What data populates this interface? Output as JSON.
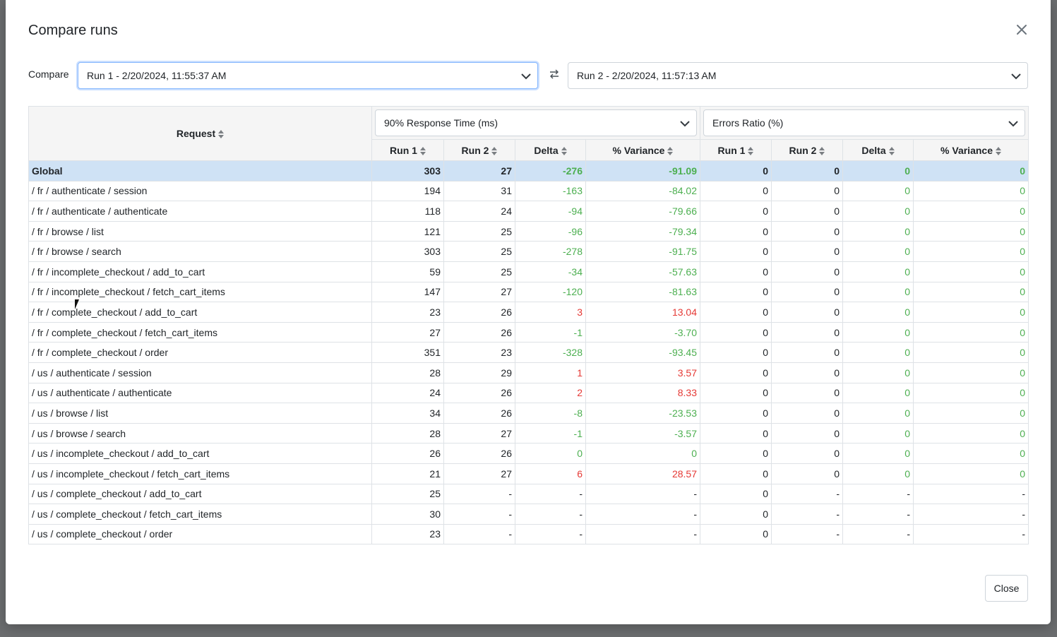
{
  "modal": {
    "title": "Compare runs",
    "close_icon": "close-icon",
    "compare_label": "Compare",
    "run_a": "Run 1 - 2/20/2024, 11:55:37 AM",
    "run_b": "Run 2 - 2/20/2024, 11:57:13 AM",
    "swap_icon": "swap-icon",
    "close_button": "Close"
  },
  "table": {
    "request_header": "Request",
    "metric_a": "90% Response Time (ms)",
    "metric_b": "Errors Ratio (%)",
    "sub_headers": [
      "Run 1",
      "Run 2",
      "Delta",
      "% Variance",
      "Run 1",
      "Run 2",
      "Delta",
      "% Variance"
    ],
    "rows": [
      {
        "req": "Global",
        "a1": "303",
        "a2": "27",
        "ad": "-276",
        "av": "-91.09",
        "b1": "0",
        "b2": "0",
        "bd": "0",
        "bv": "0",
        "as": "pos",
        "bs": "pos"
      },
      {
        "req": "/ fr / authenticate / session",
        "a1": "194",
        "a2": "31",
        "ad": "-163",
        "av": "-84.02",
        "b1": "0",
        "b2": "0",
        "bd": "0",
        "bv": "0",
        "as": "pos",
        "bs": "pos"
      },
      {
        "req": "/ fr / authenticate / authenticate",
        "a1": "118",
        "a2": "24",
        "ad": "-94",
        "av": "-79.66",
        "b1": "0",
        "b2": "0",
        "bd": "0",
        "bv": "0",
        "as": "pos",
        "bs": "pos"
      },
      {
        "req": "/ fr / browse / list",
        "a1": "121",
        "a2": "25",
        "ad": "-96",
        "av": "-79.34",
        "b1": "0",
        "b2": "0",
        "bd": "0",
        "bv": "0",
        "as": "pos",
        "bs": "pos"
      },
      {
        "req": "/ fr / browse / search",
        "a1": "303",
        "a2": "25",
        "ad": "-278",
        "av": "-91.75",
        "b1": "0",
        "b2": "0",
        "bd": "0",
        "bv": "0",
        "as": "pos",
        "bs": "pos"
      },
      {
        "req": "/ fr / incomplete_checkout / add_to_cart",
        "a1": "59",
        "a2": "25",
        "ad": "-34",
        "av": "-57.63",
        "b1": "0",
        "b2": "0",
        "bd": "0",
        "bv": "0",
        "as": "pos",
        "bs": "pos"
      },
      {
        "req": "/ fr / incomplete_checkout / fetch_cart_items",
        "a1": "147",
        "a2": "27",
        "ad": "-120",
        "av": "-81.63",
        "b1": "0",
        "b2": "0",
        "bd": "0",
        "bv": "0",
        "as": "pos",
        "bs": "pos"
      },
      {
        "req": "/ fr / complete_checkout / add_to_cart",
        "a1": "23",
        "a2": "26",
        "ad": "3",
        "av": "13.04",
        "b1": "0",
        "b2": "0",
        "bd": "0",
        "bv": "0",
        "as": "neg",
        "bs": "pos"
      },
      {
        "req": "/ fr / complete_checkout / fetch_cart_items",
        "a1": "27",
        "a2": "26",
        "ad": "-1",
        "av": "-3.70",
        "b1": "0",
        "b2": "0",
        "bd": "0",
        "bv": "0",
        "as": "pos",
        "bs": "pos"
      },
      {
        "req": "/ fr / complete_checkout / order",
        "a1": "351",
        "a2": "23",
        "ad": "-328",
        "av": "-93.45",
        "b1": "0",
        "b2": "0",
        "bd": "0",
        "bv": "0",
        "as": "pos",
        "bs": "pos"
      },
      {
        "req": "/ us / authenticate / session",
        "a1": "28",
        "a2": "29",
        "ad": "1",
        "av": "3.57",
        "b1": "0",
        "b2": "0",
        "bd": "0",
        "bv": "0",
        "as": "neg",
        "bs": "pos"
      },
      {
        "req": "/ us / authenticate / authenticate",
        "a1": "24",
        "a2": "26",
        "ad": "2",
        "av": "8.33",
        "b1": "0",
        "b2": "0",
        "bd": "0",
        "bv": "0",
        "as": "neg",
        "bs": "pos"
      },
      {
        "req": "/ us / browse / list",
        "a1": "34",
        "a2": "26",
        "ad": "-8",
        "av": "-23.53",
        "b1": "0",
        "b2": "0",
        "bd": "0",
        "bv": "0",
        "as": "pos",
        "bs": "pos"
      },
      {
        "req": "/ us / browse / search",
        "a1": "28",
        "a2": "27",
        "ad": "-1",
        "av": "-3.57",
        "b1": "0",
        "b2": "0",
        "bd": "0",
        "bv": "0",
        "as": "pos",
        "bs": "pos"
      },
      {
        "req": "/ us / incomplete_checkout / add_to_cart",
        "a1": "26",
        "a2": "26",
        "ad": "0",
        "av": "0",
        "b1": "0",
        "b2": "0",
        "bd": "0",
        "bv": "0",
        "as": "pos",
        "bs": "pos"
      },
      {
        "req": "/ us / incomplete_checkout / fetch_cart_items",
        "a1": "21",
        "a2": "27",
        "ad": "6",
        "av": "28.57",
        "b1": "0",
        "b2": "0",
        "bd": "0",
        "bv": "0",
        "as": "neg",
        "bs": "pos"
      },
      {
        "req": "/ us / complete_checkout / add_to_cart",
        "a1": "25",
        "a2": "-",
        "ad": "-",
        "av": "-",
        "b1": "0",
        "b2": "-",
        "bd": "-",
        "bv": "-",
        "as": "none",
        "bs": "none"
      },
      {
        "req": "/ us / complete_checkout / fetch_cart_items",
        "a1": "30",
        "a2": "-",
        "ad": "-",
        "av": "-",
        "b1": "0",
        "b2": "-",
        "bd": "-",
        "bv": "-",
        "as": "none",
        "bs": "none"
      },
      {
        "req": "/ us / complete_checkout / order",
        "a1": "23",
        "a2": "-",
        "ad": "-",
        "av": "-",
        "b1": "0",
        "b2": "-",
        "bd": "-",
        "bv": "-",
        "as": "none",
        "bs": "none"
      }
    ]
  },
  "colors": {
    "improvement": "#4caf50",
    "regression": "#e53935",
    "global_row_bg": "#cfe2f5",
    "header_bg": "#f5f5f5"
  }
}
